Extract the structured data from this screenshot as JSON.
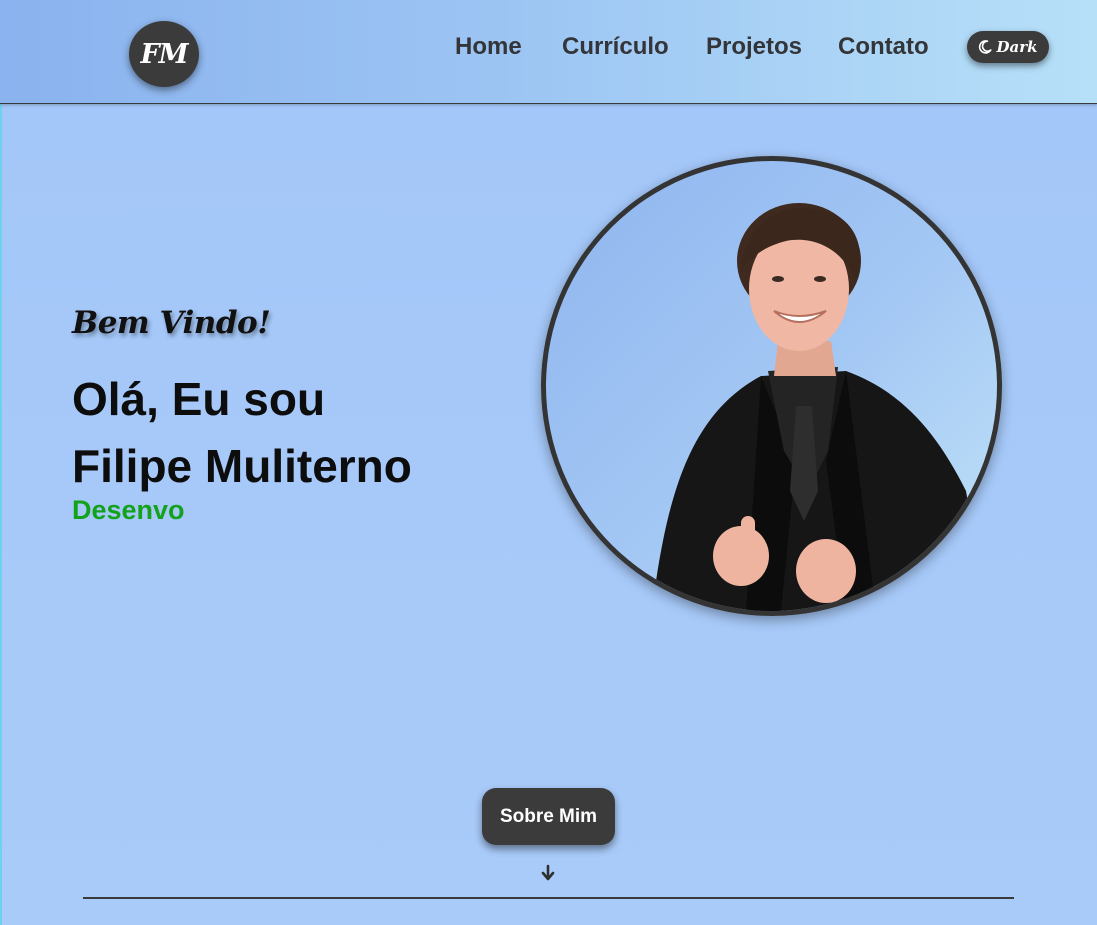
{
  "header": {
    "logo_text": "FM",
    "nav": {
      "home": "Home",
      "curriculo": "Currículo",
      "projetos": "Projetos",
      "contato": "Contato"
    },
    "theme_toggle": {
      "label": "Dark",
      "icon": "moon-icon"
    }
  },
  "hero": {
    "welcome": "Bem Vindo!",
    "intro_line1": "Olá, Eu sou",
    "intro_line2": "Filipe Muliterno",
    "role_typed": "Desenvo",
    "portrait_icon": "profile-photo"
  },
  "about": {
    "button_label": "Sobre Mim",
    "arrow_icon": "arrow-down-icon"
  },
  "colors": {
    "background": "#a3c7f8",
    "dark_accent": "#3b3b3b",
    "role_green": "#14a21d",
    "text_dark": "#0d0d0d"
  }
}
